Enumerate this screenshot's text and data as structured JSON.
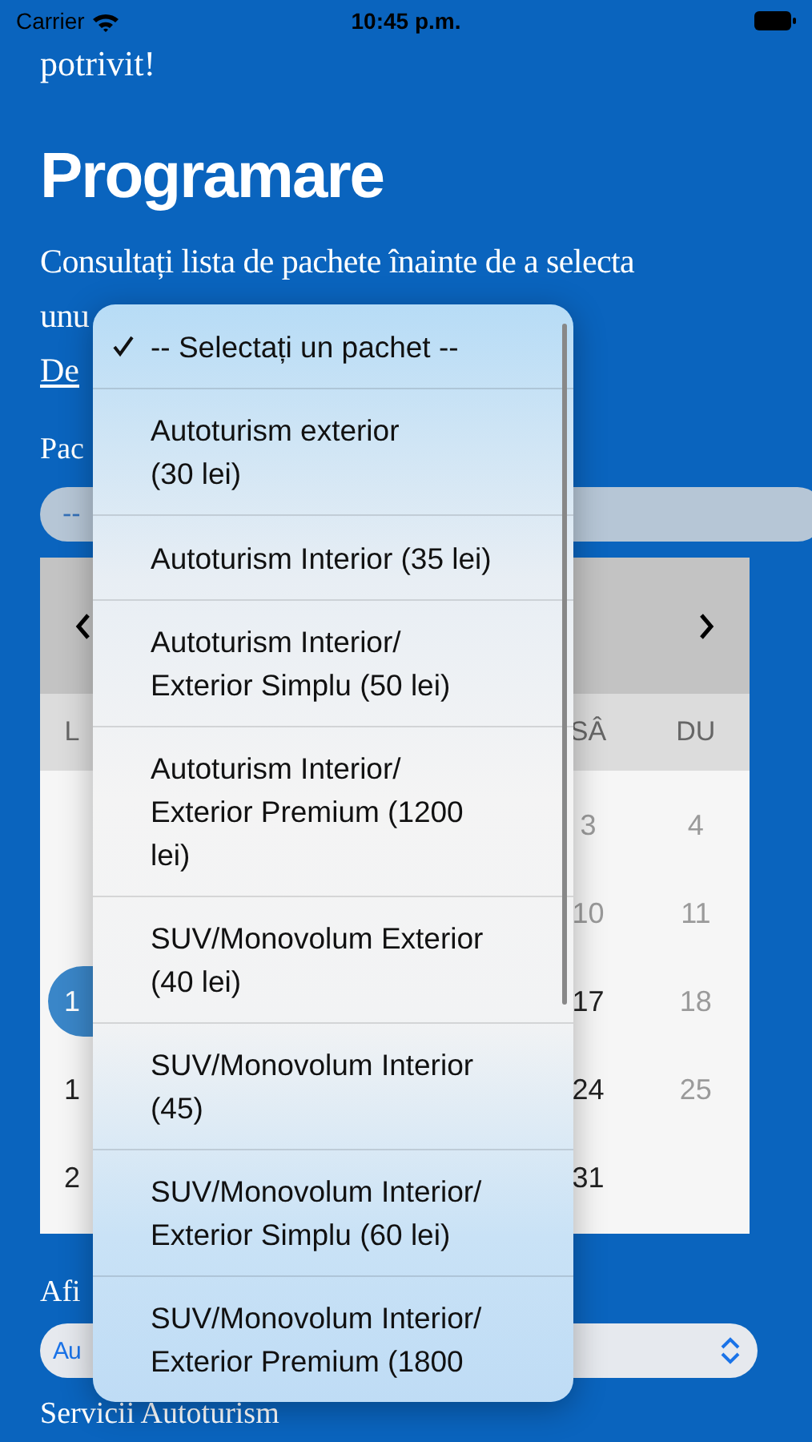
{
  "status_bar": {
    "carrier": "Carrier",
    "time": "10:45 p.m."
  },
  "intro_tail": "potrivit!",
  "title": "Programare",
  "description": {
    "lines": [
      "Consultați lista de pachete înainte de a selecta",
      "unu"
    ]
  },
  "link": "De",
  "package_field": {
    "label": "Pac",
    "value": "--"
  },
  "calendar": {
    "weekdays": {
      "first": "L",
      "last": [
        "SÂ",
        "DU"
      ]
    },
    "weeks": [
      {
        "last": [
          {
            "text": "3",
            "muted": true
          },
          {
            "text": "4",
            "muted": true
          }
        ]
      },
      {
        "last": [
          {
            "text": "10",
            "muted": true
          },
          {
            "text": "11",
            "muted": true
          }
        ]
      },
      {
        "first": {
          "text": "1",
          "selected": true
        },
        "last": [
          {
            "text": "17",
            "muted": false
          },
          {
            "text": "18",
            "muted": true
          }
        ]
      },
      {
        "first": {
          "text": "1",
          "muted": false
        },
        "last": [
          {
            "text": "24",
            "muted": false
          },
          {
            "text": "25",
            "muted": true
          }
        ]
      },
      {
        "first": {
          "text": "2",
          "muted": false
        },
        "last": [
          {
            "text": "31",
            "muted": false
          }
        ]
      }
    ]
  },
  "display_field": {
    "label": "Afi",
    "value": "Au"
  },
  "section_heading": "Servicii Autoturism",
  "menu": {
    "items": [
      {
        "lines": [
          "-- Selectați un pachet --"
        ],
        "checked": true
      },
      {
        "lines": [
          "Autoturism exterior",
          "(30 lei)"
        ],
        "checked": false
      },
      {
        "lines": [
          "Autoturism Interior (35 lei)"
        ],
        "checked": false
      },
      {
        "lines": [
          "Autoturism Interior/",
          "Exterior Simplu (50 lei)"
        ],
        "checked": false
      },
      {
        "lines": [
          "Autoturism Interior/",
          "Exterior Premium (1200",
          "lei)"
        ],
        "checked": false
      },
      {
        "lines": [
          "SUV/Monovolum Exterior",
          "(40 lei)"
        ],
        "checked": false
      },
      {
        "lines": [
          "SUV/Monovolum Interior",
          "(45)"
        ],
        "checked": false
      },
      {
        "lines": [
          "SUV/Monovolum Interior/",
          "Exterior Simplu (60 lei)"
        ],
        "checked": false
      },
      {
        "lines": [
          "SUV/Monovolum Interior/",
          "Exterior Premium (1800"
        ],
        "checked": false
      }
    ]
  }
}
